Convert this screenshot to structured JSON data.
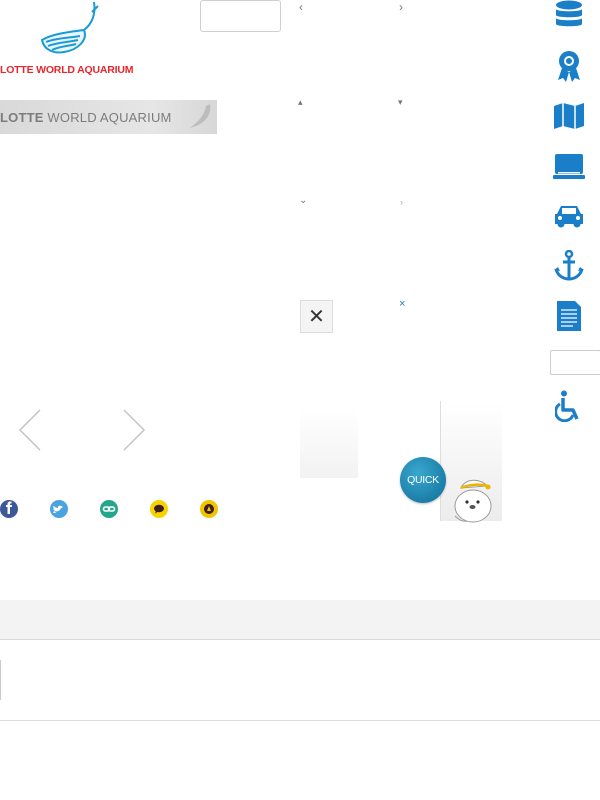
{
  "header": {
    "logo_text": "LOTTE WORLD AQUARIUM",
    "logo2_text_bold": "LOTTE",
    "logo2_text_rest": " WORLD AQUARIUM"
  },
  "close_button": {
    "label": "✕"
  },
  "quick_menu": {
    "label": "QUICK"
  },
  "arrows": {
    "left": "‹",
    "right": "›",
    "up": "▴",
    "down": "▾",
    "chev_down": "⌄",
    "chev_right": "›",
    "x_small": "×"
  },
  "right_sidebar": {
    "icons": [
      "database-icon",
      "award-icon",
      "map-icon",
      "laptop-icon",
      "car-icon",
      "anchor-icon",
      "document-icon",
      "wheelchair-icon"
    ]
  },
  "share": {
    "icons": [
      "facebook-icon",
      "twitter-icon",
      "link-icon",
      "kakaotalk-icon",
      "kakaostory-icon"
    ]
  },
  "colors": {
    "brand_red": "#e8262d",
    "brand_blue": "#1a9ad6",
    "icon_blue": "#1a7fc8",
    "facebook": "#3b5998",
    "twitter": "#4aa3df",
    "link": "#25a58a",
    "kakao": "#f7d100"
  }
}
